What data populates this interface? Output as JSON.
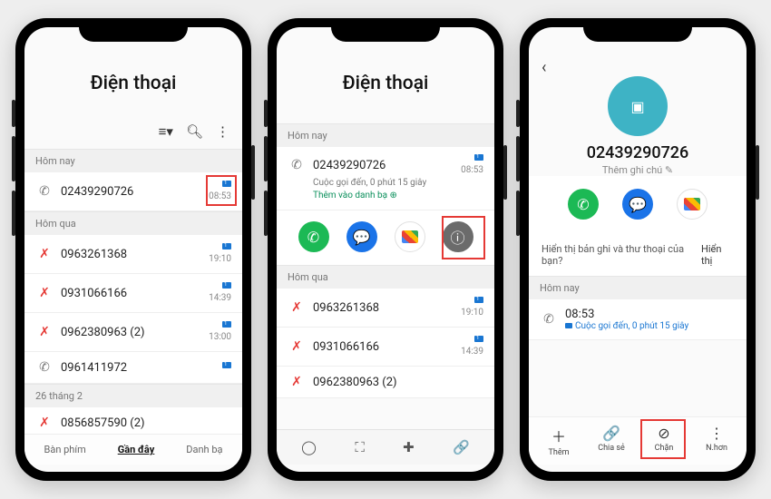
{
  "p1": {
    "title": "Điện thoại",
    "sections": {
      "today": "Hôm nay",
      "yesterday": "Hôm qua",
      "feb26": "26 tháng 2"
    },
    "calls": {
      "today": [
        {
          "num": "02439290726",
          "time": "08:53",
          "kind": "out"
        }
      ],
      "yesterday": [
        {
          "num": "0963261368",
          "time": "19:10",
          "kind": "miss"
        },
        {
          "num": "0931066166",
          "time": "14:39",
          "kind": "miss"
        },
        {
          "num": "0962380963 (2)",
          "time": "13:00",
          "kind": "miss"
        },
        {
          "num": "0961411972",
          "time": "",
          "kind": "out"
        }
      ],
      "feb26": [
        {
          "num": "0856857590 (2)",
          "time": "",
          "kind": "miss"
        }
      ]
    },
    "tabs": {
      "keypad": "Bàn phím",
      "recent": "Gần đây",
      "contacts": "Danh bạ"
    }
  },
  "p2": {
    "title": "Điện thoại",
    "sections": {
      "today": "Hôm nay",
      "yesterday": "Hôm qua"
    },
    "top": {
      "num": "02439290726",
      "time": "08:53",
      "sub": "Cuộc gọi đến, 0 phút 15 giây",
      "add": "Thêm vào danh bạ ⊕"
    },
    "yesterday": [
      {
        "num": "0963261368",
        "time": "19:10"
      },
      {
        "num": "0931066166",
        "time": "14:39"
      },
      {
        "num": "0962380963 (2)",
        "time": ""
      }
    ]
  },
  "p3": {
    "number": "02439290726",
    "note": "Thêm ghi chú ✎",
    "hint_q": "Hiển thị bản ghi và thư thoại của bạn?",
    "hint_a": "Hiển thị",
    "section": "Hôm nay",
    "call": {
      "time": "08:53",
      "detail": "Cuộc gọi đến, 0 phút 15 giây"
    },
    "actions": {
      "add": "Thêm",
      "share": "Chia sẻ",
      "block": "Chặn",
      "more": "N.hơn"
    }
  }
}
